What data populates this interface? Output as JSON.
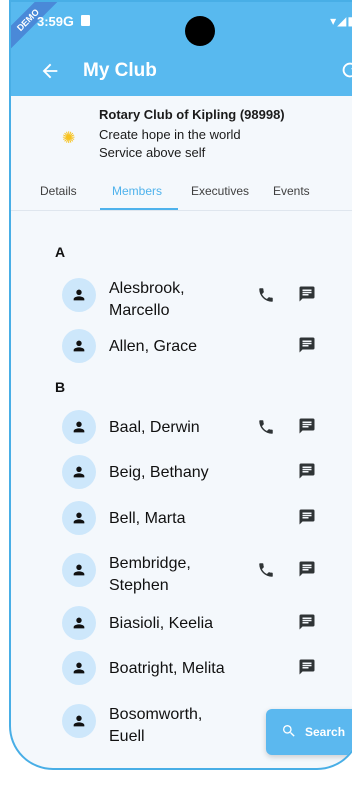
{
  "status": {
    "time": "3:59",
    "carrier_letter": "G",
    "demo_badge": "DEMO"
  },
  "appbar": {
    "title": "My Club"
  },
  "club": {
    "name": "Rotary Club of Kipling (98998)",
    "motto1": "Create hope in the world",
    "motto2": "Service above self"
  },
  "tabs": [
    "Details",
    "Members",
    "Executives",
    "Events"
  ],
  "sections": {
    "A": "A",
    "B": "B"
  },
  "members": [
    {
      "name": "Alesbrook, Marcello"
    },
    {
      "name": "Allen, Grace"
    },
    {
      "name": "Baal, Derwin"
    },
    {
      "name": "Beig, Bethany"
    },
    {
      "name": "Bell, Marta"
    },
    {
      "name": "Bembridge, Stephen"
    },
    {
      "name": "Biasioli, Keelia"
    },
    {
      "name": "Boatright, Melita"
    },
    {
      "name": "Bosomworth, Euell"
    }
  ],
  "search": {
    "label": "Search"
  },
  "colors": {
    "appbar": "#58b9ef",
    "accent": "#4eb2ec",
    "avatar_bg": "#cde7fb"
  }
}
